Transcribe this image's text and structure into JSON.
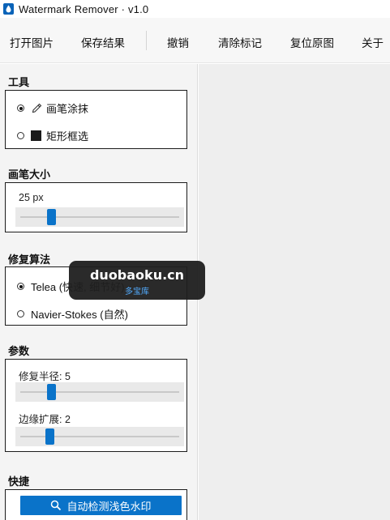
{
  "window": {
    "title": "Watermark Remover · v1.0",
    "icon": "water-drop-icon"
  },
  "menubar": {
    "items": [
      "打开图片",
      "保存结果",
      "撤销",
      "清除标记",
      "复位原图",
      "关于"
    ]
  },
  "sidebar": {
    "tools": {
      "title": "工具",
      "options": [
        {
          "label": "画笔涂抹",
          "icon": "brush-icon",
          "selected": true
        },
        {
          "label": "矩形框选",
          "icon": "rectangle-icon",
          "selected": false
        }
      ]
    },
    "brush": {
      "title": "画笔大小",
      "value_text": "25 px",
      "value": 25
    },
    "algorithm": {
      "title": "修复算法",
      "options": [
        {
          "label": "Telea (快速, 细节好)",
          "selected": true
        },
        {
          "label": "Navier-Stokes (自然)",
          "selected": false
        }
      ]
    },
    "params": {
      "title": "参数",
      "radius_label": "修复半径: 5",
      "radius_value": 5,
      "dilate_label": "边缘扩展: 2",
      "dilate_value": 2
    },
    "quick": {
      "title": "快捷",
      "auto_detect_label": "自动检测浅色水印",
      "auto_detect_icon": "search-icon"
    }
  },
  "watermark": {
    "main": "duobaoku.cn",
    "sub": "多宝库"
  },
  "colors": {
    "accent": "#0a73c9",
    "sidebar_bg": "#f4f4f4",
    "canvas_bg": "#eeeeee"
  }
}
